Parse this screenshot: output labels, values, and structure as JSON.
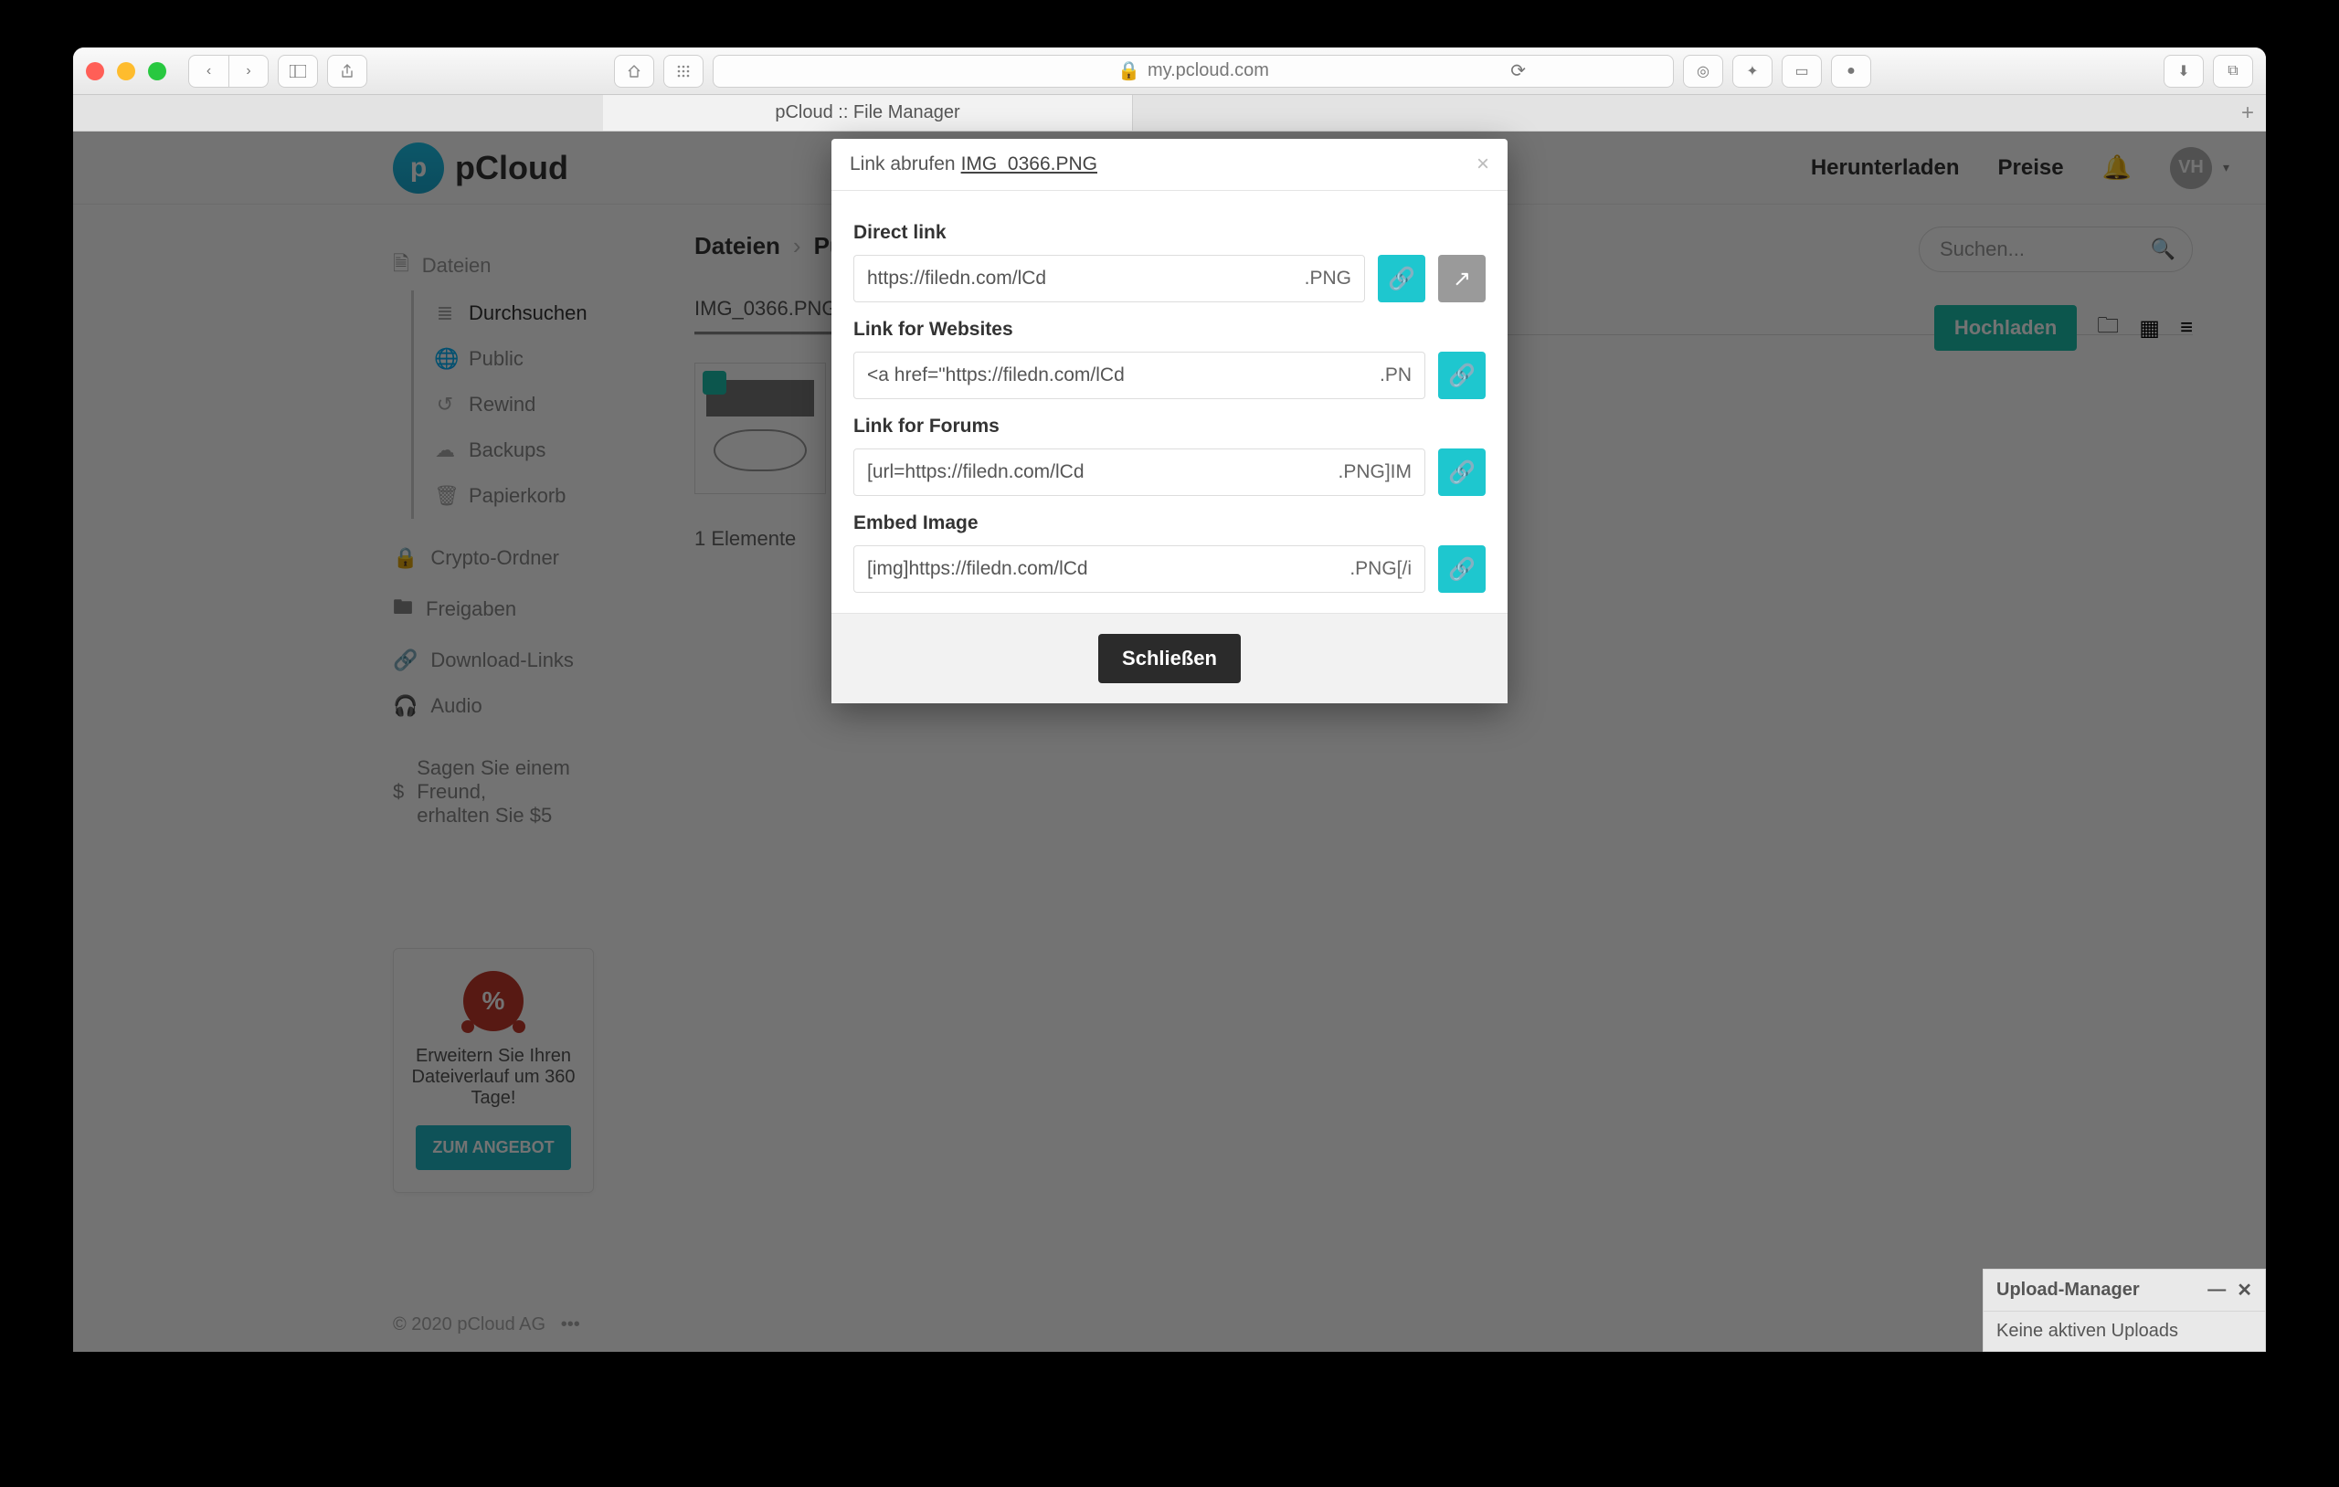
{
  "browser": {
    "url_display": "my.pcloud.com",
    "tab_title": "pCloud :: File Manager"
  },
  "brand": {
    "name": "pCloud"
  },
  "header": {
    "download_label": "Herunterladen",
    "prices_label": "Preise",
    "avatar_initials": "VH"
  },
  "sidebar": {
    "root_label": "Dateien",
    "items": [
      {
        "label": "Durchsuchen"
      },
      {
        "label": "Public"
      },
      {
        "label": "Rewind"
      },
      {
        "label": "Backups"
      },
      {
        "label": "Papierkorb"
      }
    ],
    "groups": [
      {
        "label": "Crypto-Ordner"
      },
      {
        "label": "Freigaben"
      },
      {
        "label": "Download-Links"
      },
      {
        "label": "Audio"
      }
    ],
    "referral_line1": "Sagen Sie einem Freund,",
    "referral_line2": "erhalten Sie $5"
  },
  "promo": {
    "percent": "%",
    "text": "Erweitern Sie Ihren Dateiverlauf um 360 Tage!",
    "cta": "ZUM ANGEBOT"
  },
  "breadcrumb": {
    "root": "Dateien",
    "folder": "Publ"
  },
  "file_tab": {
    "name": "IMG_0366.PNG"
  },
  "search": {
    "placeholder": "Suchen..."
  },
  "actions": {
    "upload": "Hochladen"
  },
  "listing": {
    "count_text": "1 Elemente"
  },
  "modal": {
    "title_prefix": "Link abrufen",
    "filename": "IMG_0366.PNG",
    "sections": {
      "direct": {
        "label": "Direct link",
        "value_left": "https://filedn.com/lCd",
        "value_right": ".PNG"
      },
      "website": {
        "label": "Link for Websites",
        "value_left": "<a href=\"https://filedn.com/lCd",
        "value_right": ".PN"
      },
      "forum": {
        "label": "Link for Forums",
        "value_left": "[url=https://filedn.com/lCd",
        "value_right": ".PNG]IM"
      },
      "embed": {
        "label": "Embed Image",
        "value_left": "[img]https://filedn.com/lCd",
        "value_right": ".PNG[/i"
      }
    },
    "close_label": "Schließen"
  },
  "upload_manager": {
    "title": "Upload-Manager",
    "empty": "Keine aktiven Uploads"
  },
  "footer": {
    "copy": "© 2020 pCloud AG"
  }
}
